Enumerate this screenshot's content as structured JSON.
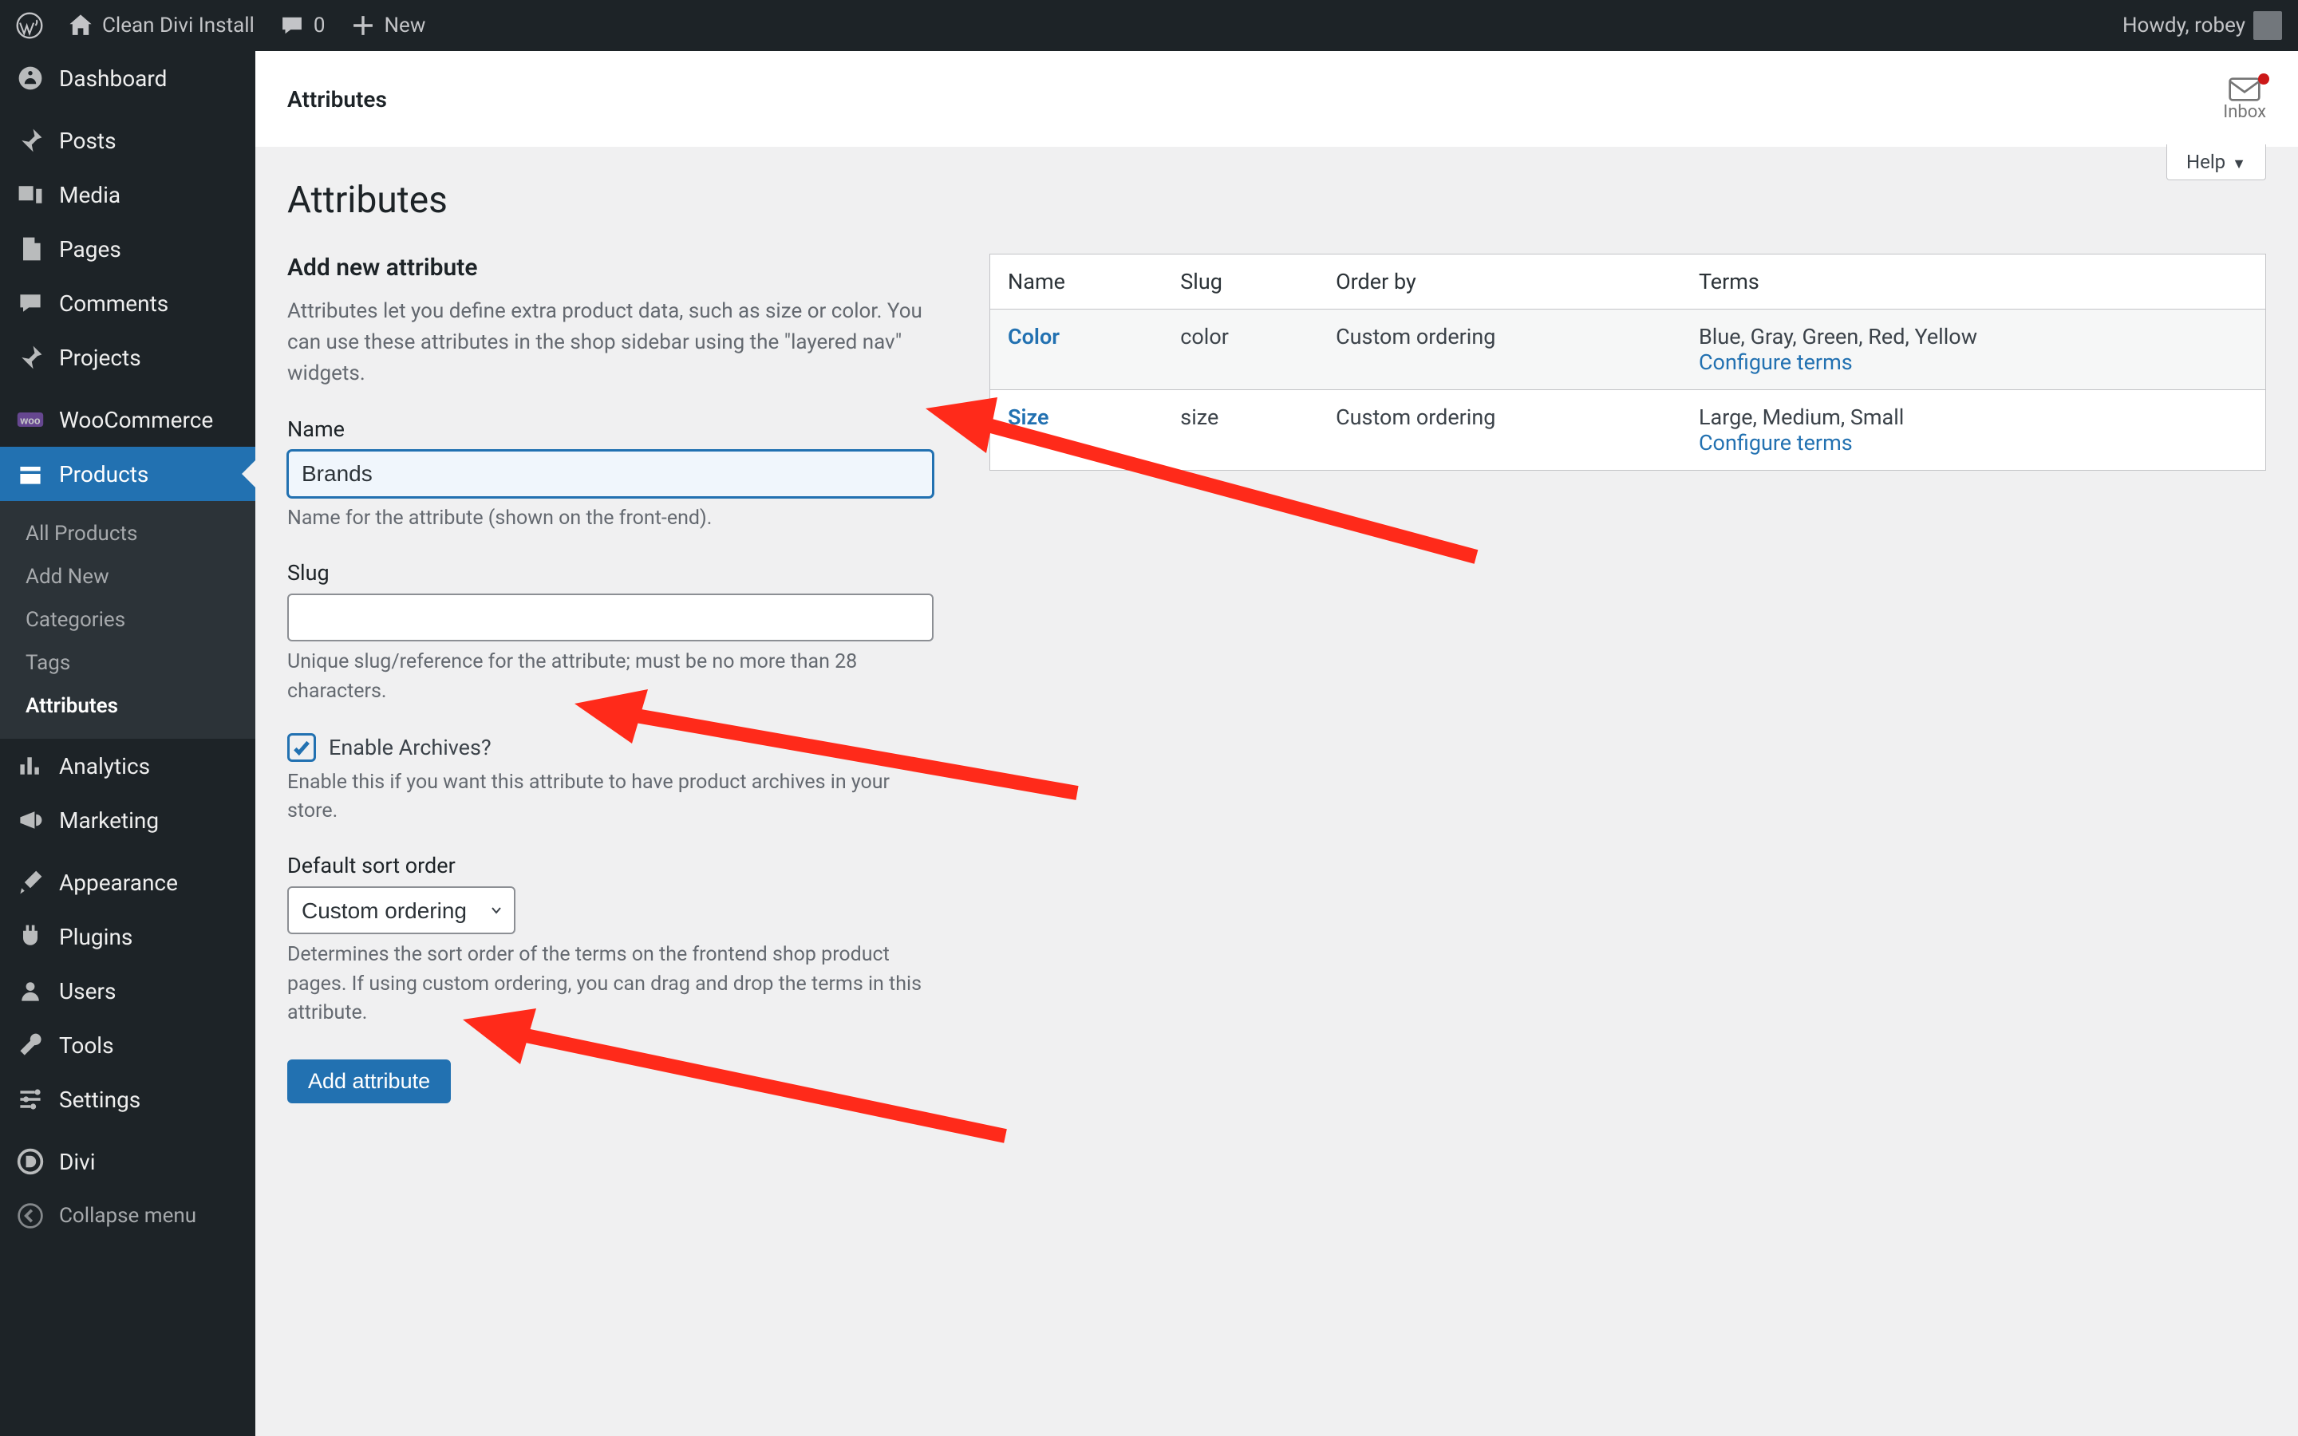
{
  "admin_bar": {
    "site_name": "Clean Divi Install",
    "comments": "0",
    "new_label": "New",
    "howdy_label": "Howdy, robey"
  },
  "sidebar": {
    "items": [
      {
        "label": "Dashboard",
        "icon": "dashboard"
      },
      {
        "label": "Posts",
        "icon": "pin"
      },
      {
        "label": "Media",
        "icon": "media"
      },
      {
        "label": "Pages",
        "icon": "pages"
      },
      {
        "label": "Comments",
        "icon": "comments"
      },
      {
        "label": "Projects",
        "icon": "pin"
      },
      {
        "label": "WooCommerce",
        "icon": "woo"
      },
      {
        "label": "Products",
        "icon": "products",
        "current": true
      },
      {
        "label": "Analytics",
        "icon": "analytics"
      },
      {
        "label": "Marketing",
        "icon": "marketing"
      },
      {
        "label": "Appearance",
        "icon": "appearance"
      },
      {
        "label": "Plugins",
        "icon": "plugin"
      },
      {
        "label": "Users",
        "icon": "users"
      },
      {
        "label": "Tools",
        "icon": "tools"
      },
      {
        "label": "Settings",
        "icon": "settings"
      },
      {
        "label": "Divi",
        "icon": "divi"
      },
      {
        "label": "Collapse menu",
        "icon": "collapse"
      }
    ],
    "submenu": {
      "items": [
        {
          "label": "All Products"
        },
        {
          "label": "Add New"
        },
        {
          "label": "Categories"
        },
        {
          "label": "Tags"
        },
        {
          "label": "Attributes",
          "current": true
        }
      ]
    }
  },
  "content_header": {
    "title": "Attributes",
    "inbox_label": "Inbox"
  },
  "help_tab": {
    "label": "Help"
  },
  "page": {
    "heading": "Attributes",
    "form": {
      "section_title": "Add new attribute",
      "intro": "Attributes let you define extra product data, such as size or color. You can use these attributes in the shop sidebar using the \"layered nav\" widgets.",
      "name_label": "Name",
      "name_value": "Brands",
      "name_help": "Name for the attribute (shown on the front-end).",
      "slug_label": "Slug",
      "slug_value": "",
      "slug_help": "Unique slug/reference for the attribute; must be no more than 28 characters.",
      "archives_label": "Enable Archives?",
      "archives_checked": true,
      "archives_help": "Enable this if you want this attribute to have product archives in your store.",
      "sort_label": "Default sort order",
      "sort_value": "Custom ordering",
      "sort_help": "Determines the sort order of the terms on the frontend shop product pages. If using custom ordering, you can drag and drop the terms in this attribute.",
      "submit_label": "Add attribute"
    },
    "table": {
      "headers": {
        "name": "Name",
        "slug": "Slug",
        "orderby": "Order by",
        "terms": "Terms"
      },
      "configure_label": "Configure terms",
      "rows": [
        {
          "name": "Color",
          "slug": "color",
          "orderby": "Custom ordering",
          "terms": "Blue, Gray, Green, Red, Yellow"
        },
        {
          "name": "Size",
          "slug": "size",
          "orderby": "Custom ordering",
          "terms": "Large, Medium, Small"
        }
      ]
    }
  }
}
